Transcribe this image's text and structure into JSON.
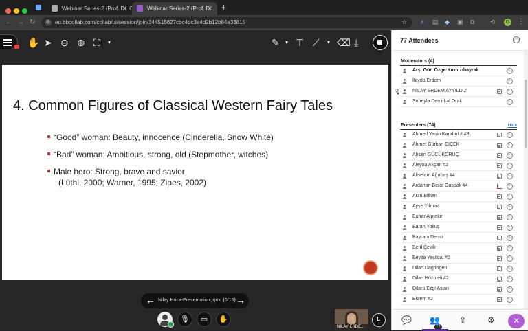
{
  "browser": {
    "tabs": [
      {
        "label": "Webinar Series-2 (Prof. Dr. C...",
        "active": false
      },
      {
        "label": "Webinar Series-2 (Prof. D...",
        "active": true
      }
    ],
    "new_tab": "+",
    "url": "eu.bbcollab.com/collab/ui/session/join/344515627cbc4dc3a4d2b12b84a33815",
    "profile_initial": "G"
  },
  "slide": {
    "title": "4. Common Figures of Classical Western Fairy Tales",
    "bullets": [
      {
        "text": "“Good” woman: Beauty, innocence (Cinderella, Snow White)"
      },
      {
        "text": "“Bad” woman: Ambitious, strong, old (Stepmother, witches)"
      },
      {
        "text": "Male hero: Strong, brave and savior",
        "line2": "(Lüthi, 2000; Warner, 1995; Zipes, 2002)"
      }
    ]
  },
  "pager": {
    "file": "Nilay Hoca-Presentation.pptx",
    "page": "(6/16)",
    "prev": "←",
    "next": "→"
  },
  "video": {
    "name": "NILAY ERDE..."
  },
  "panel": {
    "title": "77 Attendees",
    "tab_count": "77",
    "moderators": {
      "label": "Moderators (4)",
      "people": [
        {
          "name": "Arş. Gör. Özge Kırmızıbayrak",
          "bold": true,
          "cap": "none",
          "mic": false
        },
        {
          "name": "İlayda Erdem",
          "bold": false,
          "cap": "none",
          "mic": false
        },
        {
          "name": "NILAY ERDEM AYYILDIZ",
          "bold": false,
          "cap": "gray",
          "mic": true
        },
        {
          "name": "Suheyla Demirkol Orak",
          "bold": false,
          "cap": "none",
          "mic": false
        }
      ]
    },
    "presenters": {
      "label": "Presenters (74)",
      "hide_label": "Hide",
      "people": [
        {
          "name": "Ahmed Yasin Karabulut #3",
          "cap": "gray"
        },
        {
          "name": "Ahmet Gürkan ÇİÇEK",
          "cap": "gray"
        },
        {
          "name": "Ahsen GÜCÜKORUÇ",
          "cap": "gray"
        },
        {
          "name": "Aleyna Akçan #2",
          "cap": "gray"
        },
        {
          "name": "Aliselam Ağırbaş #4",
          "cap": "gray"
        },
        {
          "name": "Ardahan Berat Gaspak #4",
          "cap": "red"
        },
        {
          "name": "Arzu Bilhan",
          "cap": "gray"
        },
        {
          "name": "Ayşe Yılmaz",
          "cap": "gray"
        },
        {
          "name": "Bahar Alptekin",
          "cap": "gray"
        },
        {
          "name": "Baran Yokuş",
          "cap": "gray"
        },
        {
          "name": "Bayram Demir",
          "cap": "gray"
        },
        {
          "name": "Beril Çevik",
          "cap": "gray"
        },
        {
          "name": "Beyza Yeşildal #2",
          "cap": "gray"
        },
        {
          "name": "Dilan Dağdöğen",
          "cap": "gray"
        },
        {
          "name": "Dilan Hüzmeli #2",
          "cap": "gray"
        },
        {
          "name": "Dilara Ezgi Aslan",
          "cap": "gray"
        },
        {
          "name": "Ekrem #2",
          "cap": "gray"
        }
      ]
    }
  },
  "icons": {
    "option": "⋯",
    "chat": "💬",
    "attendees": "👥",
    "share": "⇪",
    "settings": "⚙",
    "close": "✕"
  },
  "colors": {
    "accent": "#5a2a9e",
    "close_fab": "#b05ad6",
    "bullet": "#c0392b",
    "record": "#c0391e"
  }
}
